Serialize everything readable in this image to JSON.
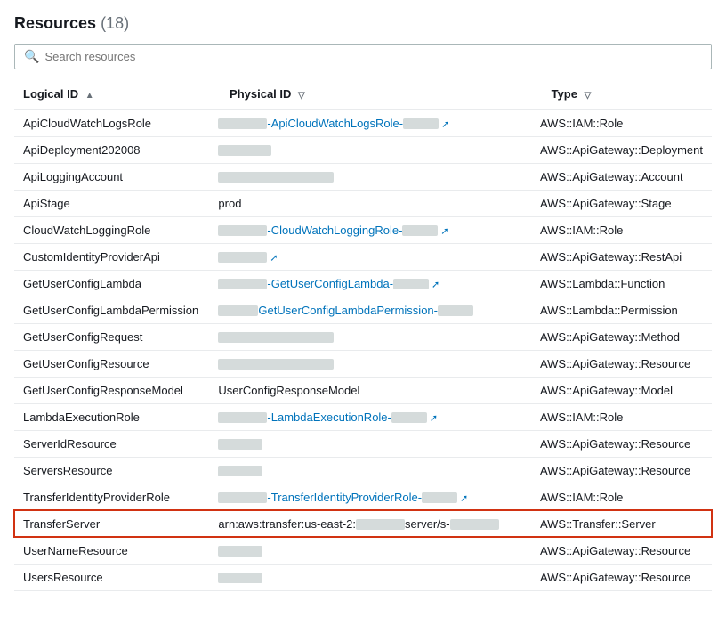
{
  "header": {
    "title": "Resources",
    "count": "(18)"
  },
  "search": {
    "placeholder": "Search resources"
  },
  "columns": [
    {
      "key": "logical_id",
      "label": "Logical ID",
      "sort": "asc"
    },
    {
      "key": "physical_id",
      "label": "Physical ID",
      "filter": true
    },
    {
      "key": "type",
      "label": "Type",
      "filter": true
    }
  ],
  "rows": [
    {
      "logical_id": "ApiCloudWatchLogsRole",
      "physical_id_type": "link",
      "physical_id_pre": "",
      "physical_id_link": "-ApiCloudWatchLogsRole-",
      "physical_id_post": "",
      "type": "AWS::IAM::Role",
      "highlight": false
    },
    {
      "logical_id": "ApiDeployment202008",
      "physical_id_type": "redacted",
      "type": "AWS::ApiGateway::Deployment",
      "highlight": false
    },
    {
      "logical_id": "ApiLoggingAccount",
      "physical_id_type": "redacted_long",
      "type": "AWS::ApiGateway::Account",
      "highlight": false
    },
    {
      "logical_id": "ApiStage",
      "physical_id_type": "text",
      "physical_id_text": "prod",
      "type": "AWS::ApiGateway::Stage",
      "highlight": false
    },
    {
      "logical_id": "CloudWatchLoggingRole",
      "physical_id_type": "link",
      "physical_id_link": "-CloudWatchLoggingRole-",
      "type": "AWS::IAM::Role",
      "highlight": false
    },
    {
      "logical_id": "CustomIdentityProviderApi",
      "physical_id_type": "link_short",
      "type": "AWS::ApiGateway::RestApi",
      "highlight": false
    },
    {
      "logical_id": "GetUserConfigLambda",
      "physical_id_type": "link",
      "physical_id_link": "-GetUserConfigLambda-",
      "type": "AWS::Lambda::Function",
      "highlight": false
    },
    {
      "logical_id": "GetUserConfigLambdaPermission",
      "physical_id_type": "link_permission",
      "physical_id_link": "GetUserConfigLambdaPermission-",
      "type": "AWS::Lambda::Permission",
      "highlight": false
    },
    {
      "logical_id": "GetUserConfigRequest",
      "physical_id_type": "redacted_long",
      "type": "AWS::ApiGateway::Method",
      "highlight": false
    },
    {
      "logical_id": "GetUserConfigResource",
      "physical_id_type": "redacted_long",
      "type": "AWS::ApiGateway::Resource",
      "highlight": false
    },
    {
      "logical_id": "GetUserConfigResponseModel",
      "physical_id_type": "text",
      "physical_id_text": "UserConfigResponseModel",
      "type": "AWS::ApiGateway::Model",
      "highlight": false
    },
    {
      "logical_id": "LambdaExecutionRole",
      "physical_id_type": "link",
      "physical_id_link": "-LambdaExecutionRole-",
      "type": "AWS::IAM::Role",
      "highlight": false
    },
    {
      "logical_id": "ServerIdResource",
      "physical_id_type": "redacted_short",
      "type": "AWS::ApiGateway::Resource",
      "highlight": false
    },
    {
      "logical_id": "ServersResource",
      "physical_id_type": "redacted_short",
      "type": "AWS::ApiGateway::Resource",
      "highlight": false
    },
    {
      "logical_id": "TransferIdentityProviderRole",
      "physical_id_type": "link",
      "physical_id_link": "-TransferIdentityProviderRole-",
      "type": "AWS::IAM::Role",
      "highlight": false
    },
    {
      "logical_id": "TransferServer",
      "physical_id_type": "arn",
      "physical_id_arn_pre": "arn:aws:transfer:us-east-2:",
      "physical_id_arn_post": "server/s-",
      "type": "AWS::Transfer::Server",
      "highlight": true
    },
    {
      "logical_id": "UserNameResource",
      "physical_id_type": "redacted_short",
      "type": "AWS::ApiGateway::Resource",
      "highlight": false
    },
    {
      "logical_id": "UsersResource",
      "physical_id_type": "redacted_short",
      "type": "AWS::ApiGateway::Resource",
      "highlight": false
    }
  ]
}
